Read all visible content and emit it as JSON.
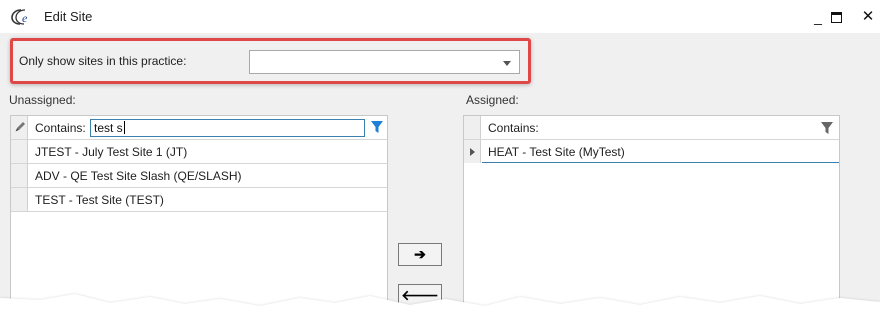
{
  "window": {
    "title": "Edit Site",
    "minimize_glyph": "_",
    "maximize_glyph": "",
    "close_glyph": "✕"
  },
  "practice_filter": {
    "label": "Only show sites in this practice:",
    "value": ""
  },
  "unassigned": {
    "label": "Unassigned:",
    "contains_label": "Contains:",
    "search_value": "test s",
    "rows": [
      "JTEST - July Test Site 1 (JT)",
      "ADV - QE Test Site Slash (QE/SLASH)",
      "TEST - Test Site (TEST)"
    ]
  },
  "assigned": {
    "label": "Assigned:",
    "contains_label": "Contains:",
    "rows": [
      "HEAT - Test Site (MyTest)"
    ]
  },
  "buttons": {
    "assign": "➔",
    "unassign": "🡐"
  },
  "colors": {
    "highlight": "#e04848",
    "active_filter": "#1e7fd6",
    "selection_line": "#3c7fb1"
  },
  "icons": [
    "app-logo-icon",
    "pencil-icon",
    "filter-icon",
    "expander-icon",
    "dropdown-arrow-icon"
  ]
}
